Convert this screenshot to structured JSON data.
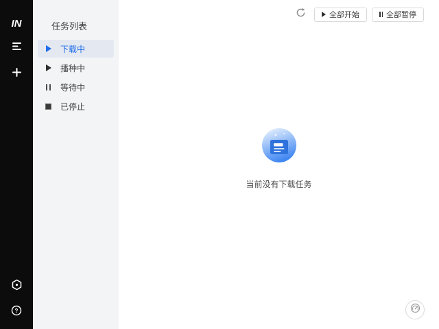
{
  "app": {
    "logo_text": "IN"
  },
  "sidebar": {
    "icons": [
      {
        "name": "task-list-icon"
      },
      {
        "name": "add-task-icon"
      },
      {
        "name": "settings-icon"
      },
      {
        "name": "help-icon"
      }
    ]
  },
  "task_panel": {
    "title": "任务列表",
    "items": [
      {
        "label": "下载中",
        "icon": "play-icon",
        "active": true
      },
      {
        "label": "播种中",
        "icon": "play-icon",
        "active": false
      },
      {
        "label": "等待中",
        "icon": "pause-icon",
        "active": false
      },
      {
        "label": "已停止",
        "icon": "stop-icon",
        "active": false
      }
    ]
  },
  "toolbar": {
    "refresh_icon": "circular-arrow",
    "start_all_label": "全部开始",
    "pause_all_label": "全部暂停"
  },
  "empty_state": {
    "icon": "document-in-blue-circle",
    "message": "当前没有下载任务"
  },
  "speed_button": {
    "icon": "speed-gauge"
  },
  "colors": {
    "accent": "#1f6ce8",
    "sidebar_bg": "#0c0c0c",
    "panel_bg": "#f3f4f6",
    "active_item_bg": "#e3e8f1",
    "empty_icon_blue": "#3f86f2"
  }
}
